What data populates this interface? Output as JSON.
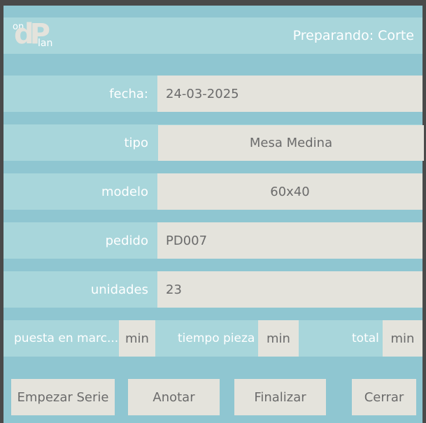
{
  "header": {
    "logo": {
      "line1": "on",
      "letters": "dP",
      "line2": "lan"
    },
    "status": "Preparando: Corte"
  },
  "form": {
    "fecha": {
      "label": "fecha:",
      "value": "24-03-2025"
    },
    "tipo": {
      "label": "tipo",
      "value": "Mesa Medina"
    },
    "modelo": {
      "label": "modelo",
      "value": "60x40"
    },
    "pedido": {
      "label": "pedido",
      "value": "PD007"
    },
    "unidades": {
      "label": "unidades",
      "value": "23"
    }
  },
  "times": {
    "puesta": {
      "label": "puesta en marc...",
      "unit": "min"
    },
    "pieza": {
      "label": "tiempo pieza",
      "unit": "min"
    },
    "total": {
      "label": "total",
      "unit": "min"
    }
  },
  "actions": {
    "start": "Empezar Serie",
    "note": "Anotar",
    "finish": "Finalizar",
    "close": "Cerrar"
  },
  "colors": {
    "background": "#4a4a4a",
    "band": "#8fc6d1",
    "row": "#a8d6db",
    "field": "#e4e3dc",
    "text": "#6b6b6b"
  }
}
